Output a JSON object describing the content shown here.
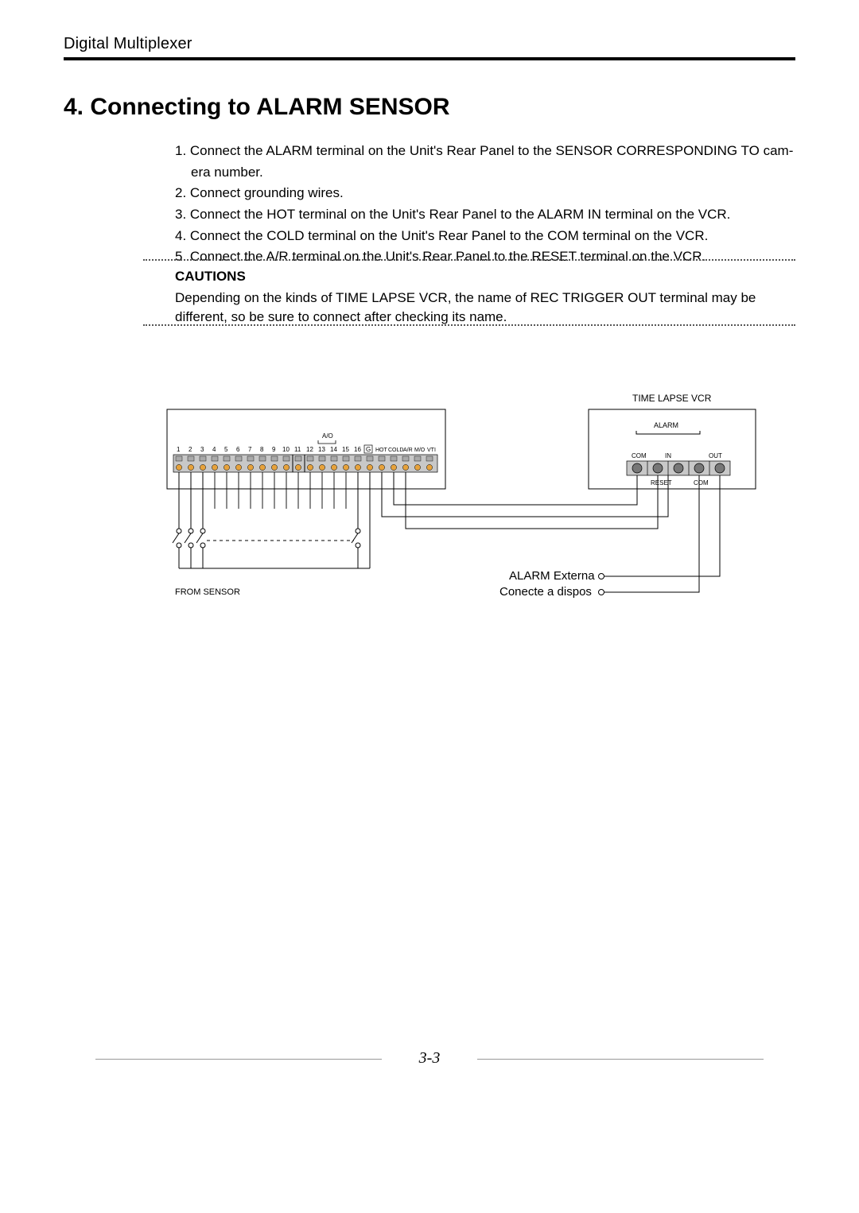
{
  "header": {
    "product": "Digital Multiplexer"
  },
  "section": {
    "title": "4. Connecting to ALARM SENSOR"
  },
  "steps": {
    "s1a": "1. Connect the ALARM terminal on the Unit's Rear Panel to the SENSOR CORRESPONDING TO cam-",
    "s1b": "era number.",
    "s2": "2. Connect grounding wires.",
    "s3": "3. Connect the HOT terminal on the Unit's Rear Panel to the ALARM IN terminal on the VCR.",
    "s4": "4. Connect the COLD terminal on the Unit's Rear Panel to the COM terminal on the VCR.",
    "s5": "5. Connect the A/R terminal on the Unit's Rear Panel to the RESET terminal on the VCR."
  },
  "cautions": {
    "title": "CAUTIONS",
    "body": "Depending on the kinds of TIME LAPSE VCR, the name of REC TRIGGER OUT terminal may be different, so be sure to connect after checking its name."
  },
  "diagram": {
    "vcr_title": "TIME LAPSE VCR",
    "alarm_label": "ALARM",
    "vcr_terminals": {
      "com1": "COM",
      "in": "IN",
      "out": "OUT",
      "reset": "RESET",
      "com2": "COM"
    },
    "terminal_numbers": [
      "1",
      "2",
      "3",
      "4",
      "5",
      "6",
      "7",
      "8",
      "9",
      "10",
      "11",
      "12",
      "13",
      "14",
      "15",
      "16"
    ],
    "terminal_g": "G",
    "terminal_hot": "HOT",
    "terminal_cold": "COLD",
    "terminal_ar": "A/R",
    "terminal_mo": "M/O",
    "terminal_vti": "VTI",
    "ao_label": "A/O",
    "from_sensor": "FROM SENSOR",
    "alarm_externa": "ALARM Externa",
    "conecte_dispos": "Conecte a dispos"
  },
  "footer": {
    "page": "3-3"
  }
}
